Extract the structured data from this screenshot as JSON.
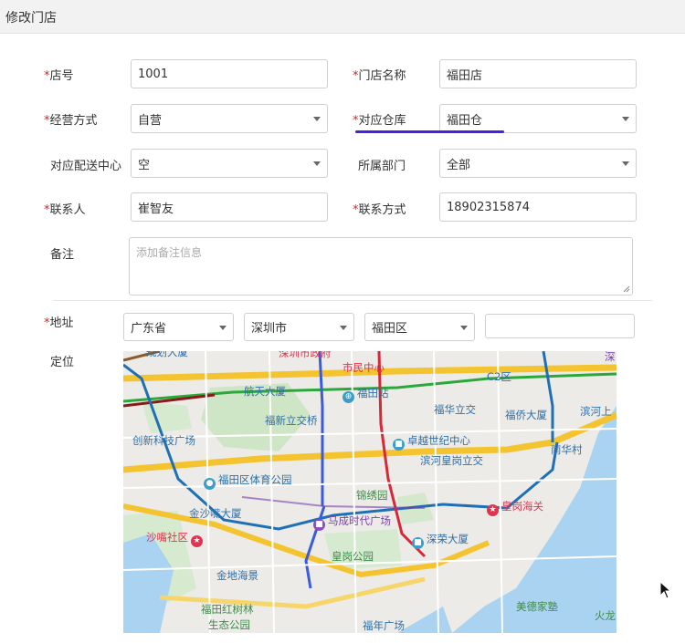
{
  "header": {
    "title": "修改门店"
  },
  "form": {
    "store_no": {
      "required_mark": "*",
      "label": "店号",
      "value": "1001"
    },
    "store_name": {
      "required_mark": "*",
      "label": "门店名称",
      "value": "福田店"
    },
    "business_mode": {
      "required_mark": "*",
      "label": "经营方式",
      "value": "自营"
    },
    "warehouse": {
      "required_mark": "*",
      "label": "对应仓库",
      "value": "福田仓"
    },
    "dist_center": {
      "label": "对应配送中心",
      "value": "空"
    },
    "department": {
      "label": "所属部门",
      "value": "全部"
    },
    "contact": {
      "required_mark": "*",
      "label": "联系人",
      "value": "崔智友"
    },
    "phone": {
      "required_mark": "*",
      "label": "联系方式",
      "value": "18902315874"
    },
    "remark": {
      "label": "备注",
      "placeholder": "添加备注信息"
    },
    "address": {
      "required_mark": "*",
      "label": "地址",
      "province": "广东省",
      "city": "深圳市",
      "district": "福田区",
      "detail": ""
    },
    "location": {
      "label": "定位"
    }
  },
  "map": {
    "pois": [
      {
        "text": "规划大厦",
        "color": "blue"
      },
      {
        "text": "深圳市政府",
        "color": "red"
      },
      {
        "text": "市民中心",
        "color": "red"
      },
      {
        "text": "C2区",
        "color": "blue"
      },
      {
        "text": "深",
        "color": "purple"
      },
      {
        "text": "航天大厦",
        "color": "blue"
      },
      {
        "text": "福田站",
        "color": "blue"
      },
      {
        "text": "福华立交",
        "color": "blue"
      },
      {
        "text": "福侨大厦",
        "color": "blue"
      },
      {
        "text": "滨河上",
        "color": "blue"
      },
      {
        "text": "福新立交桥",
        "color": "blue"
      },
      {
        "text": "创新科技广场",
        "color": "blue"
      },
      {
        "text": "卓越世纪中心",
        "color": "blue"
      },
      {
        "text": "南华村",
        "color": "blue"
      },
      {
        "text": "滨河皇岗立交",
        "color": "blue"
      },
      {
        "text": "福田区体育公园",
        "color": "blue"
      },
      {
        "text": "锦绣园",
        "color": "green"
      },
      {
        "text": "金沙嘴大厦",
        "color": "blue"
      },
      {
        "text": "皇岗海关",
        "color": "red"
      },
      {
        "text": "马成时代广场",
        "color": "purple"
      },
      {
        "text": "沙嘴社区",
        "color": "red"
      },
      {
        "text": "深荣大厦",
        "color": "blue"
      },
      {
        "text": "皇岗公园",
        "color": "green"
      },
      {
        "text": "金地海景",
        "color": "blue"
      },
      {
        "text": "美德家塾",
        "color": "green"
      },
      {
        "text": "福田红树林",
        "color": "green"
      },
      {
        "text": "生态公园",
        "color": "green"
      },
      {
        "text": "福年广场",
        "color": "blue"
      },
      {
        "text": "火龙",
        "color": "green"
      }
    ]
  }
}
